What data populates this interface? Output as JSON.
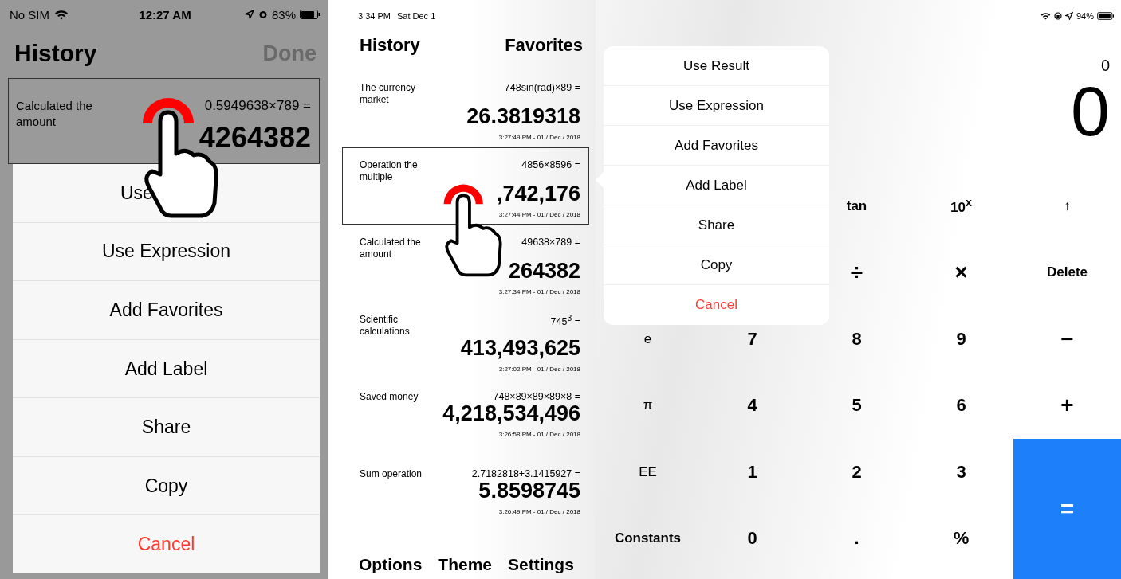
{
  "phone": {
    "status_bar": {
      "carrier": "No SIM",
      "time": "12:27 AM",
      "battery": "83%"
    },
    "title": "History",
    "done_button": "Done",
    "selected_entry": {
      "label": "Calculated the amount",
      "expression": "0.5949638×789 =",
      "result": "4264382"
    },
    "actions": [
      {
        "label": "Use",
        "kind": "covered"
      },
      {
        "label": "Use Expression",
        "kind": "normal"
      },
      {
        "label": "Add Favorites",
        "kind": "normal"
      },
      {
        "label": "Add Label",
        "kind": "normal"
      },
      {
        "label": "Share",
        "kind": "normal"
      },
      {
        "label": "Copy",
        "kind": "normal"
      },
      {
        "label": "Cancel",
        "kind": "destructive"
      }
    ]
  },
  "tablet": {
    "status_bar": {
      "time": "3:34 PM",
      "date": "Sat Dec 1",
      "battery": "94%"
    },
    "panel_titles": [
      "History",
      "Favorites"
    ],
    "entries": [
      {
        "label": "The currency market",
        "expression": "748sin(rad)×89 =",
        "result": "26.3819318",
        "time": "3:27:49 PM - 01 / Dec / 2018",
        "selected": false
      },
      {
        "label": "Operation the multiple",
        "expression": "4856×8596 =",
        "result": ",742,176",
        "time": "3:27:44 PM - 01 / Dec / 2018",
        "selected": true
      },
      {
        "label": "Calculated the amount",
        "expression": "49638×789 =",
        "result": "264382",
        "time": "3:27:34 PM - 01 / Dec / 2018",
        "selected": false
      },
      {
        "label": "Scientific calculations",
        "expression": "745$^{3}$ =",
        "result": "413,493,625",
        "time": "3:27:02 PM - 01 / Dec / 2018",
        "selected": false
      },
      {
        "label": "Saved money",
        "expression": "748×89×89×89×8 =",
        "result": "4,218,534,496",
        "time": "3:26:58 PM - 01 / Dec / 2018",
        "selected": false
      },
      {
        "label": "Sum operation",
        "expression": "2.7182818+3.1415927 =",
        "result": "5.8598745",
        "time": "3:26:49 PM - 01 / Dec / 2018",
        "selected": false
      }
    ],
    "bottom_menu": [
      "Options",
      "Theme",
      "Settings"
    ],
    "popover": [
      {
        "label": "Use Result",
        "kind": "normal"
      },
      {
        "label": "Use Expression",
        "kind": "normal"
      },
      {
        "label": "Add Favorites",
        "kind": "normal"
      },
      {
        "label": "Add Label",
        "kind": "normal"
      },
      {
        "label": "Share",
        "kind": "normal"
      },
      {
        "label": "Copy",
        "kind": "normal"
      },
      {
        "label": "Cancel",
        "kind": "destructive"
      }
    ],
    "display": {
      "expression": "0",
      "value": "0"
    },
    "key_rows": [
      [
        {
          "label": "tan",
          "kind": "function"
        },
        {
          "label": "10$^{x}$",
          "kind": "function"
        }
      ],
      [
        {
          "label": "÷",
          "kind": "operator"
        },
        {
          "label": "×",
          "kind": "operator"
        }
      ],
      [
        {
          "label": "e",
          "kind": "symbol"
        },
        {
          "label": "7",
          "kind": "digit"
        },
        {
          "label": "8",
          "kind": "digit"
        },
        {
          "label": "9",
          "kind": "digit"
        }
      ],
      [
        {
          "label": "π",
          "kind": "symbol"
        },
        {
          "label": "4",
          "kind": "digit"
        },
        {
          "label": "5",
          "kind": "digit"
        },
        {
          "label": "6",
          "kind": "digit"
        }
      ],
      [
        {
          "label": "EE",
          "kind": "symbol"
        },
        {
          "label": "1",
          "kind": "digit"
        },
        {
          "label": "2",
          "kind": "digit"
        },
        {
          "label": "3",
          "kind": "digit"
        }
      ],
      [
        {
          "label": "Constants",
          "kind": "function"
        },
        {
          "label": "0",
          "kind": "digit"
        },
        {
          "label": ".",
          "kind": "digit"
        },
        {
          "label": "%",
          "kind": "digit"
        }
      ]
    ],
    "side_keys": [
      {
        "label": "↑",
        "kind": "symbol"
      },
      {
        "label": "Delete",
        "kind": "function"
      },
      {
        "label": "−",
        "kind": "operator"
      },
      {
        "label": "+",
        "kind": "operator"
      },
      {
        "label": "=",
        "kind": "equals"
      }
    ]
  }
}
